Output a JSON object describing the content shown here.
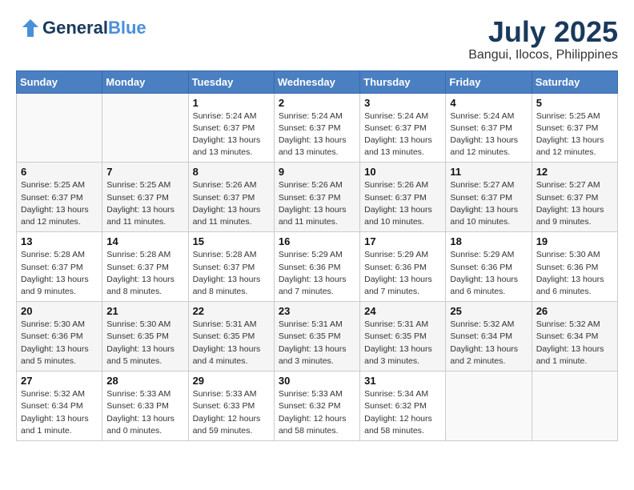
{
  "header": {
    "logo_general": "General",
    "logo_blue": "Blue",
    "month": "July 2025",
    "location": "Bangui, Ilocos, Philippines"
  },
  "days_of_week": [
    "Sunday",
    "Monday",
    "Tuesday",
    "Wednesday",
    "Thursday",
    "Friday",
    "Saturday"
  ],
  "weeks": [
    [
      {
        "day": "",
        "info": ""
      },
      {
        "day": "",
        "info": ""
      },
      {
        "day": "1",
        "info": "Sunrise: 5:24 AM\nSunset: 6:37 PM\nDaylight: 13 hours\nand 13 minutes."
      },
      {
        "day": "2",
        "info": "Sunrise: 5:24 AM\nSunset: 6:37 PM\nDaylight: 13 hours\nand 13 minutes."
      },
      {
        "day": "3",
        "info": "Sunrise: 5:24 AM\nSunset: 6:37 PM\nDaylight: 13 hours\nand 13 minutes."
      },
      {
        "day": "4",
        "info": "Sunrise: 5:24 AM\nSunset: 6:37 PM\nDaylight: 13 hours\nand 12 minutes."
      },
      {
        "day": "5",
        "info": "Sunrise: 5:25 AM\nSunset: 6:37 PM\nDaylight: 13 hours\nand 12 minutes."
      }
    ],
    [
      {
        "day": "6",
        "info": "Sunrise: 5:25 AM\nSunset: 6:37 PM\nDaylight: 13 hours\nand 12 minutes."
      },
      {
        "day": "7",
        "info": "Sunrise: 5:25 AM\nSunset: 6:37 PM\nDaylight: 13 hours\nand 11 minutes."
      },
      {
        "day": "8",
        "info": "Sunrise: 5:26 AM\nSunset: 6:37 PM\nDaylight: 13 hours\nand 11 minutes."
      },
      {
        "day": "9",
        "info": "Sunrise: 5:26 AM\nSunset: 6:37 PM\nDaylight: 13 hours\nand 11 minutes."
      },
      {
        "day": "10",
        "info": "Sunrise: 5:26 AM\nSunset: 6:37 PM\nDaylight: 13 hours\nand 10 minutes."
      },
      {
        "day": "11",
        "info": "Sunrise: 5:27 AM\nSunset: 6:37 PM\nDaylight: 13 hours\nand 10 minutes."
      },
      {
        "day": "12",
        "info": "Sunrise: 5:27 AM\nSunset: 6:37 PM\nDaylight: 13 hours\nand 9 minutes."
      }
    ],
    [
      {
        "day": "13",
        "info": "Sunrise: 5:28 AM\nSunset: 6:37 PM\nDaylight: 13 hours\nand 9 minutes."
      },
      {
        "day": "14",
        "info": "Sunrise: 5:28 AM\nSunset: 6:37 PM\nDaylight: 13 hours\nand 8 minutes."
      },
      {
        "day": "15",
        "info": "Sunrise: 5:28 AM\nSunset: 6:37 PM\nDaylight: 13 hours\nand 8 minutes."
      },
      {
        "day": "16",
        "info": "Sunrise: 5:29 AM\nSunset: 6:36 PM\nDaylight: 13 hours\nand 7 minutes."
      },
      {
        "day": "17",
        "info": "Sunrise: 5:29 AM\nSunset: 6:36 PM\nDaylight: 13 hours\nand 7 minutes."
      },
      {
        "day": "18",
        "info": "Sunrise: 5:29 AM\nSunset: 6:36 PM\nDaylight: 13 hours\nand 6 minutes."
      },
      {
        "day": "19",
        "info": "Sunrise: 5:30 AM\nSunset: 6:36 PM\nDaylight: 13 hours\nand 6 minutes."
      }
    ],
    [
      {
        "day": "20",
        "info": "Sunrise: 5:30 AM\nSunset: 6:36 PM\nDaylight: 13 hours\nand 5 minutes."
      },
      {
        "day": "21",
        "info": "Sunrise: 5:30 AM\nSunset: 6:35 PM\nDaylight: 13 hours\nand 5 minutes."
      },
      {
        "day": "22",
        "info": "Sunrise: 5:31 AM\nSunset: 6:35 PM\nDaylight: 13 hours\nand 4 minutes."
      },
      {
        "day": "23",
        "info": "Sunrise: 5:31 AM\nSunset: 6:35 PM\nDaylight: 13 hours\nand 3 minutes."
      },
      {
        "day": "24",
        "info": "Sunrise: 5:31 AM\nSunset: 6:35 PM\nDaylight: 13 hours\nand 3 minutes."
      },
      {
        "day": "25",
        "info": "Sunrise: 5:32 AM\nSunset: 6:34 PM\nDaylight: 13 hours\nand 2 minutes."
      },
      {
        "day": "26",
        "info": "Sunrise: 5:32 AM\nSunset: 6:34 PM\nDaylight: 13 hours\nand 1 minute."
      }
    ],
    [
      {
        "day": "27",
        "info": "Sunrise: 5:32 AM\nSunset: 6:34 PM\nDaylight: 13 hours\nand 1 minute."
      },
      {
        "day": "28",
        "info": "Sunrise: 5:33 AM\nSunset: 6:33 PM\nDaylight: 13 hours\nand 0 minutes."
      },
      {
        "day": "29",
        "info": "Sunrise: 5:33 AM\nSunset: 6:33 PM\nDaylight: 12 hours\nand 59 minutes."
      },
      {
        "day": "30",
        "info": "Sunrise: 5:33 AM\nSunset: 6:32 PM\nDaylight: 12 hours\nand 58 minutes."
      },
      {
        "day": "31",
        "info": "Sunrise: 5:34 AM\nSunset: 6:32 PM\nDaylight: 12 hours\nand 58 minutes."
      },
      {
        "day": "",
        "info": ""
      },
      {
        "day": "",
        "info": ""
      }
    ]
  ]
}
